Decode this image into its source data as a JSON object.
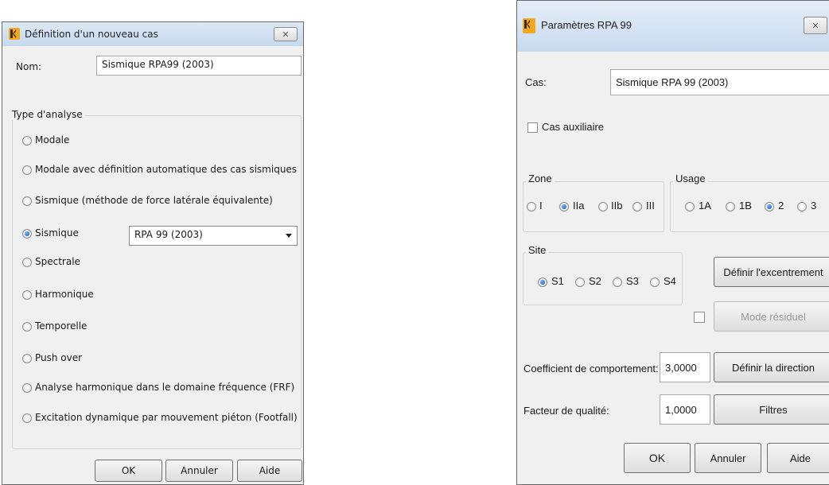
{
  "left_dialog": {
    "title": "Définition d'un nouveau cas",
    "close_icon": "close-x-icon",
    "name_label": "Nom:",
    "name_value": "Sismique RPA99 (2003)",
    "analysis_group_label": "Type d'analyse",
    "analysis_types": [
      "Modale",
      "Modale avec définition automatique des cas sismiques",
      "Sismique (méthode de force latérale équivalente)",
      "Sismique",
      "Spectrale",
      "Harmonique",
      "Temporelle",
      "Push over",
      "Analyse harmonique dans le domaine fréquence (FRF)",
      "Excitation dynamique par mouvement piéton (Footfall)"
    ],
    "selected_analysis": "Sismique",
    "seismic_standard": "RPA 99 (2003)",
    "ok_label": "OK",
    "cancel_label": "Annuler",
    "help_label": "Aide"
  },
  "right_dialog": {
    "title": "Paramètres RPA 99",
    "close_icon": "close-x-icon",
    "case_label": "Cas:",
    "case_value": "Sismique RPA 99 (2003)",
    "auxiliary_label": "Cas auxiliaire",
    "auxiliary_checked": false,
    "zone": {
      "label": "Zone",
      "options": [
        "I",
        "IIa",
        "IIb",
        "III"
      ],
      "selected": "IIa"
    },
    "usage": {
      "label": "Usage",
      "options": [
        "1A",
        "1B",
        "2",
        "3"
      ],
      "selected": "2"
    },
    "site": {
      "label": "Site",
      "options": [
        "S1",
        "S2",
        "S3",
        "S4"
      ],
      "selected": "S1"
    },
    "define_eccentricity_label": "Définir l'excentrement",
    "residual_mode_label": "Mode résiduel",
    "residual_mode_checked": false,
    "behavior_coef_label": "Coefficient de comportement:",
    "behavior_coef_value": "3,0000",
    "define_direction_label": "Définir la direction",
    "quality_factor_label": "Facteur de qualité:",
    "quality_factor_value": "1,0000",
    "filters_label": "Filtres",
    "ok_label": "OK",
    "cancel_label": "Annuler",
    "help_label": "Aide"
  }
}
